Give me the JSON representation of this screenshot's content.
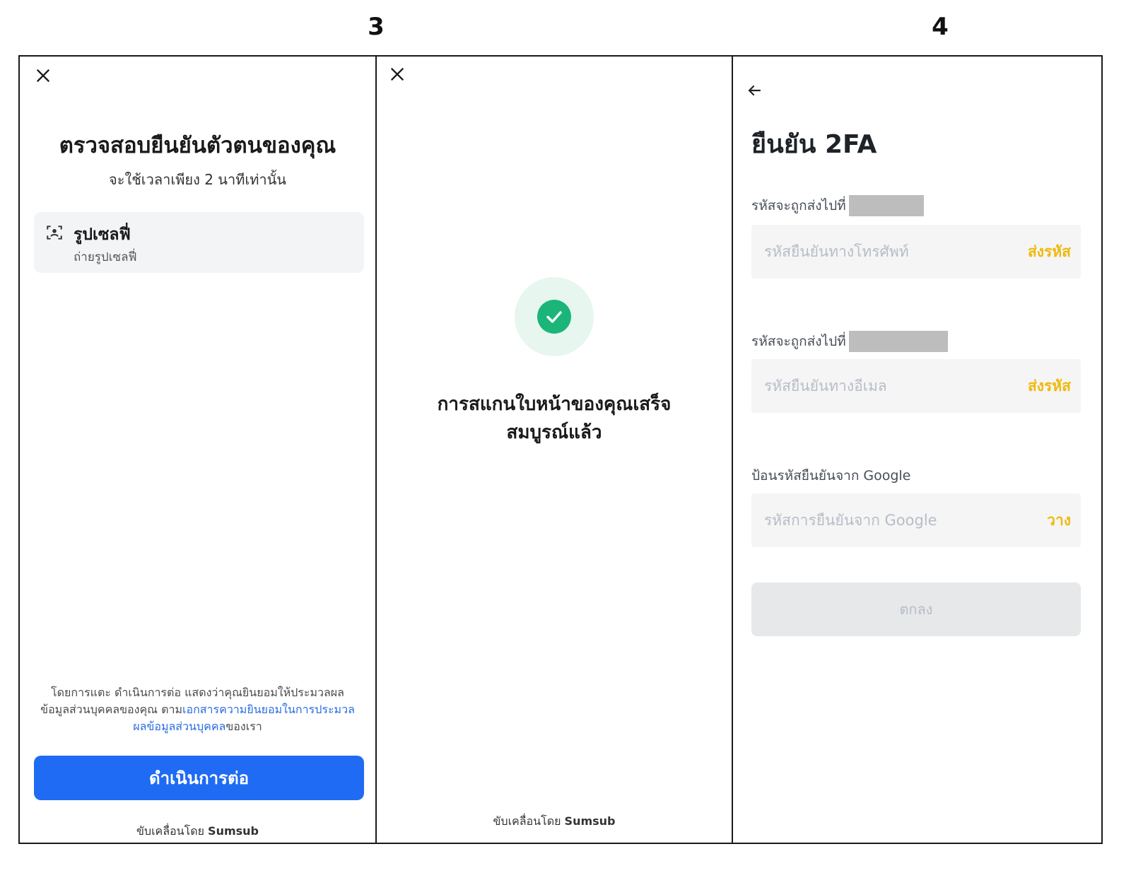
{
  "steps": {
    "left": "3",
    "right": "4"
  },
  "verify": {
    "title": "ตรวจสอบยืนยันตัวตนของคุณ",
    "subtitle": "จะใช้เวลาเพียง 2 นาทีเท่านั้น",
    "selfie_title": "รูปเซลฟี่",
    "selfie_subtitle": "ถ่ายรูปเซลฟี่",
    "consent_prefix": "โดยการแตะ ดำเนินการต่อ แสดงว่าคุณยินยอมให้ประมวลผลข้อมูลส่วนบุคคลของคุณ ตาม",
    "consent_link": "เอกสารความยินยอมในการประมวลผลข้อมูลส่วนบุคคล",
    "consent_suffix": "ของเรา",
    "continue_label": "ดำเนินการต่อ",
    "powered_prefix": "ขับเคลื่อนโดย ",
    "powered_brand": "Sumsub"
  },
  "success": {
    "message_line1": "การสแกนใบหน้าของคุณเสร็จ",
    "message_line2": "สมบูรณ์แล้ว",
    "powered_prefix": "ขับเคลื่อนโดย ",
    "powered_brand": "Sumsub"
  },
  "twofa": {
    "title": "ยืนยัน 2FA",
    "phone_label": "รหัสจะถูกส่งไปที่",
    "phone_placeholder": "รหัสยืนยันทางโทรศัพท์",
    "phone_action": "ส่งรหัส",
    "email_label": "รหัสจะถูกส่งไปที่",
    "email_placeholder": "รหัสยืนยันทางอีเมล",
    "email_action": "ส่งรหัส",
    "google_label": "ป้อนรหัสยืนยันจาก Google",
    "google_placeholder": "รหัสการยืนยันจาก Google",
    "google_action": "วาง",
    "submit_label": "ตกลง"
  },
  "colors": {
    "primary_blue": "#1f6bf4",
    "accent_yellow": "#f0b90b",
    "success_green": "#1bb57a"
  },
  "icons": [
    "close-icon",
    "selfie-icon",
    "check-icon",
    "back-arrow-icon"
  ]
}
